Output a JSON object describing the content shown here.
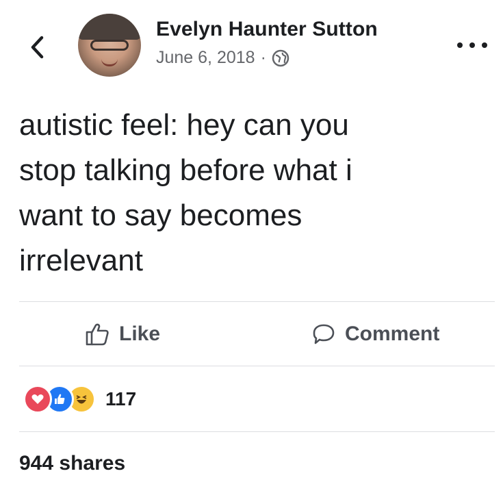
{
  "header": {
    "author_name": "Evelyn Haunter Sutton",
    "date": "June 6, 2018",
    "separator": "·",
    "privacy_icon": "globe-icon",
    "back_icon": "chevron-left-icon",
    "more_icon": "more-dots-icon"
  },
  "post": {
    "text": "autistic feel: hey can you\nstop talking before what i\nwant to say becomes\nirrelevant"
  },
  "actions": {
    "like_label": "Like",
    "comment_label": "Comment"
  },
  "reactions": {
    "types": [
      "love",
      "like",
      "haha"
    ],
    "count": "117"
  },
  "shares": {
    "label": "944 shares"
  },
  "colors": {
    "text_primary": "#1c1e21",
    "text_secondary": "#65676b",
    "action_text": "#4b4f56",
    "divider": "#dcdde0",
    "love": "#e9485a",
    "like": "#2078f4",
    "haha": "#f7c33c"
  }
}
